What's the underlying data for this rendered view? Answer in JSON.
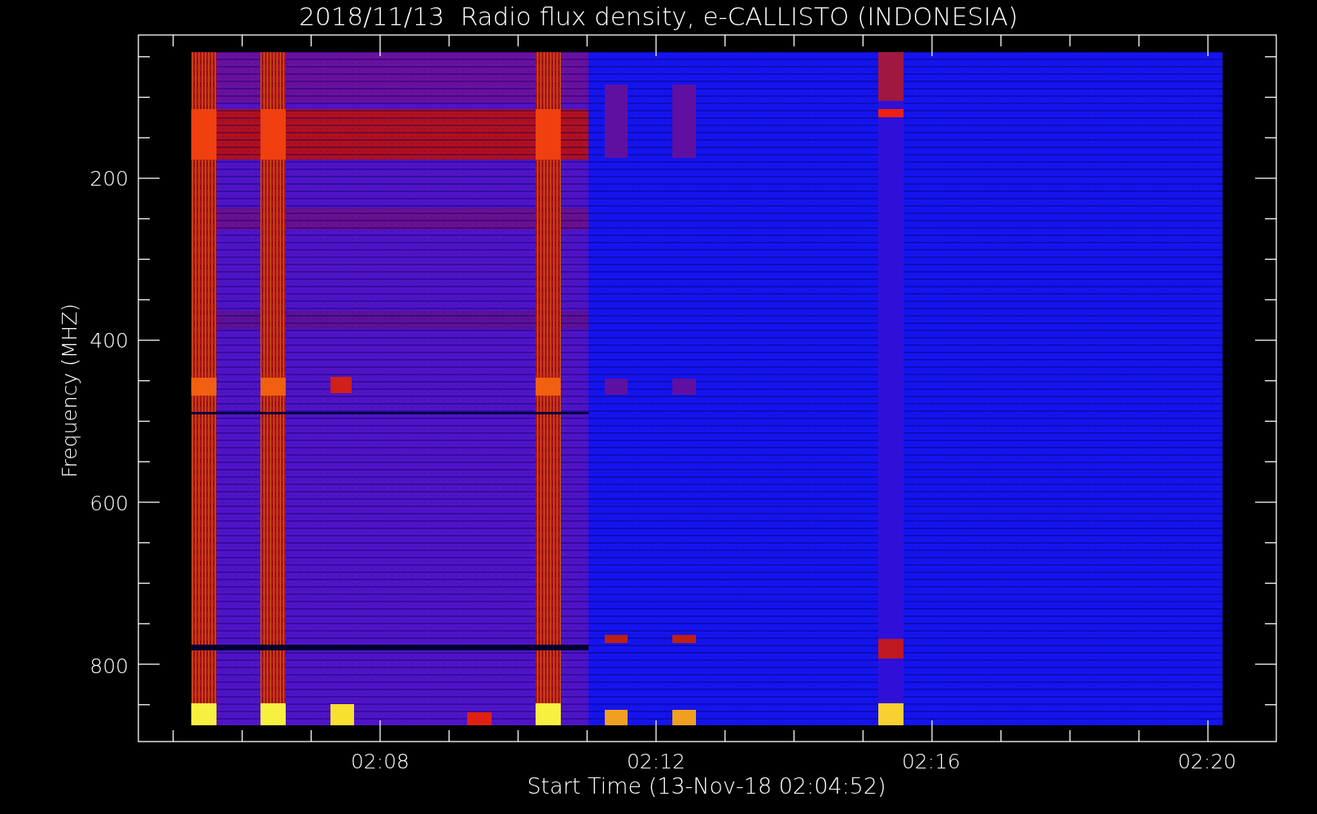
{
  "title": "2018/11/13  Radio flux density, e-CALLISTO (INDONESIA)",
  "plot": {
    "ylabel": "Frequency (MHZ)",
    "xlabel": "Start Time (13-Nov-18 02:04:52)",
    "yticks": [
      "200",
      "400",
      "600",
      "800"
    ],
    "xticks": [
      "02:08",
      "02:12",
      "02:16",
      "02:20"
    ]
  }
}
